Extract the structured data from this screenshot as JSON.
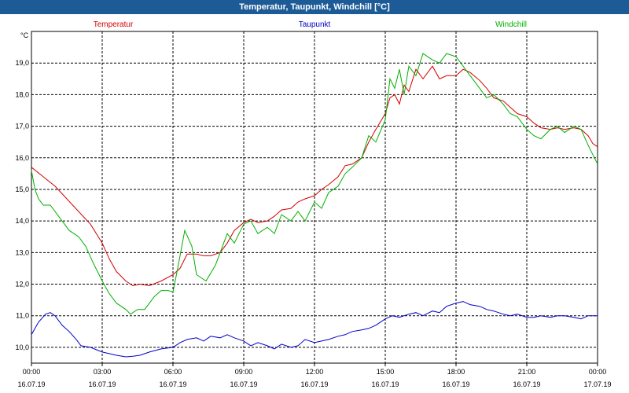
{
  "window": {
    "title": "Temperatur, Taupunkt, Windchill [°C]"
  },
  "chart_data": {
    "type": "line",
    "title": "Temperatur, Taupunkt, Windchill [°C]",
    "ylabel": "°C",
    "xlim": [
      0,
      24
    ],
    "ylim": [
      9.5,
      20.0
    ],
    "grid": true,
    "legend_position": "top",
    "y_ticks": [
      "10,0",
      "11,0",
      "12,0",
      "13,0",
      "14,0",
      "15,0",
      "16,0",
      "17,0",
      "18,0",
      "19,0"
    ],
    "y_tick_values": [
      10,
      11,
      12,
      13,
      14,
      15,
      16,
      17,
      18,
      19
    ],
    "x_ticks": [
      {
        "time": "00:00",
        "date": "16.07.19"
      },
      {
        "time": "03:00",
        "date": "16.07.19"
      },
      {
        "time": "06:00",
        "date": "16.07.19"
      },
      {
        "time": "09:00",
        "date": "16.07.19"
      },
      {
        "time": "12:00",
        "date": "16.07.19"
      },
      {
        "time": "15:00",
        "date": "16.07.19"
      },
      {
        "time": "18:00",
        "date": "16.07.19"
      },
      {
        "time": "21:00",
        "date": "16.07.19"
      },
      {
        "time": "00:00",
        "date": "17.07.19"
      }
    ],
    "series": [
      {
        "name": "Temperatur",
        "color": "#d40000",
        "points": [
          [
            0,
            15.7
          ],
          [
            0.5,
            15.4
          ],
          [
            1,
            15.1
          ],
          [
            1.5,
            14.7
          ],
          [
            2,
            14.3
          ],
          [
            2.5,
            13.9
          ],
          [
            3,
            13.3
          ],
          [
            3.3,
            12.8
          ],
          [
            3.6,
            12.4
          ],
          [
            4,
            12.1
          ],
          [
            4.3,
            11.95
          ],
          [
            4.6,
            12.0
          ],
          [
            5,
            11.95
          ],
          [
            5.5,
            12.1
          ],
          [
            6,
            12.3
          ],
          [
            6.3,
            12.5
          ],
          [
            6.6,
            12.95
          ],
          [
            7,
            12.95
          ],
          [
            7.3,
            12.9
          ],
          [
            7.6,
            12.9
          ],
          [
            8,
            13.0
          ],
          [
            8.3,
            13.3
          ],
          [
            8.6,
            13.7
          ],
          [
            9,
            13.95
          ],
          [
            9.3,
            14.05
          ],
          [
            9.6,
            13.95
          ],
          [
            10,
            14.0
          ],
          [
            10.3,
            14.15
          ],
          [
            10.6,
            14.35
          ],
          [
            11,
            14.4
          ],
          [
            11.3,
            14.6
          ],
          [
            11.6,
            14.7
          ],
          [
            12,
            14.8
          ],
          [
            12.3,
            15.0
          ],
          [
            12.6,
            15.15
          ],
          [
            13,
            15.4
          ],
          [
            13.3,
            15.75
          ],
          [
            13.6,
            15.8
          ],
          [
            14,
            16.0
          ],
          [
            14.3,
            16.5
          ],
          [
            14.6,
            16.9
          ],
          [
            15,
            17.4
          ],
          [
            15.2,
            17.9
          ],
          [
            15.4,
            18.0
          ],
          [
            15.6,
            17.7
          ],
          [
            15.8,
            18.3
          ],
          [
            16,
            18.1
          ],
          [
            16.3,
            18.8
          ],
          [
            16.6,
            18.5
          ],
          [
            17,
            18.9
          ],
          [
            17.3,
            18.5
          ],
          [
            17.6,
            18.6
          ],
          [
            18,
            18.6
          ],
          [
            18.3,
            18.8
          ],
          [
            18.6,
            18.7
          ],
          [
            19,
            18.45
          ],
          [
            19.3,
            18.2
          ],
          [
            19.6,
            17.9
          ],
          [
            20,
            17.8
          ],
          [
            20.3,
            17.6
          ],
          [
            20.6,
            17.4
          ],
          [
            21,
            17.3
          ],
          [
            21.3,
            17.1
          ],
          [
            21.6,
            16.95
          ],
          [
            22,
            16.9
          ],
          [
            22.3,
            16.95
          ],
          [
            22.6,
            16.9
          ],
          [
            23,
            16.95
          ],
          [
            23.3,
            16.9
          ],
          [
            23.6,
            16.7
          ],
          [
            23.8,
            16.45
          ],
          [
            24,
            16.35
          ]
        ]
      },
      {
        "name": "Taupunkt",
        "color": "#0000c8",
        "points": [
          [
            0,
            10.4
          ],
          [
            0.3,
            10.8
          ],
          [
            0.6,
            11.05
          ],
          [
            0.8,
            11.1
          ],
          [
            1,
            11.0
          ],
          [
            1.3,
            10.7
          ],
          [
            1.6,
            10.5
          ],
          [
            1.9,
            10.25
          ],
          [
            2.1,
            10.05
          ],
          [
            2.5,
            10.0
          ],
          [
            3,
            9.85
          ],
          [
            3.3,
            9.8
          ],
          [
            3.6,
            9.75
          ],
          [
            4,
            9.7
          ],
          [
            4.3,
            9.72
          ],
          [
            4.6,
            9.75
          ],
          [
            5,
            9.85
          ],
          [
            5.5,
            9.95
          ],
          [
            6,
            10.0
          ],
          [
            6.3,
            10.15
          ],
          [
            6.6,
            10.25
          ],
          [
            7,
            10.3
          ],
          [
            7.3,
            10.2
          ],
          [
            7.6,
            10.35
          ],
          [
            8,
            10.3
          ],
          [
            8.3,
            10.4
          ],
          [
            8.6,
            10.3
          ],
          [
            9,
            10.2
          ],
          [
            9.3,
            10.05
          ],
          [
            9.6,
            10.15
          ],
          [
            10,
            10.05
          ],
          [
            10.3,
            9.95
          ],
          [
            10.6,
            10.1
          ],
          [
            11,
            10.0
          ],
          [
            11.3,
            10.05
          ],
          [
            11.6,
            10.25
          ],
          [
            12,
            10.15
          ],
          [
            12.3,
            10.2
          ],
          [
            12.6,
            10.25
          ],
          [
            13,
            10.35
          ],
          [
            13.3,
            10.4
          ],
          [
            13.6,
            10.5
          ],
          [
            14,
            10.55
          ],
          [
            14.3,
            10.6
          ],
          [
            14.6,
            10.7
          ],
          [
            15,
            10.9
          ],
          [
            15.3,
            11.0
          ],
          [
            15.6,
            10.95
          ],
          [
            16,
            11.05
          ],
          [
            16.3,
            11.1
          ],
          [
            16.6,
            11.0
          ],
          [
            17,
            11.15
          ],
          [
            17.3,
            11.1
          ],
          [
            17.6,
            11.3
          ],
          [
            18,
            11.4
          ],
          [
            18.3,
            11.45
          ],
          [
            18.6,
            11.35
          ],
          [
            19,
            11.3
          ],
          [
            19.3,
            11.2
          ],
          [
            19.6,
            11.15
          ],
          [
            20,
            11.05
          ],
          [
            20.3,
            11.0
          ],
          [
            20.6,
            11.05
          ],
          [
            21,
            10.95
          ],
          [
            21.3,
            10.95
          ],
          [
            21.6,
            11.0
          ],
          [
            22,
            10.95
          ],
          [
            22.3,
            11.0
          ],
          [
            22.6,
            11.0
          ],
          [
            23,
            10.95
          ],
          [
            23.3,
            10.9
          ],
          [
            23.6,
            11.0
          ],
          [
            24,
            11.0
          ]
        ]
      },
      {
        "name": "Windchill",
        "color": "#00b000",
        "points": [
          [
            0,
            15.6
          ],
          [
            0.15,
            15.0
          ],
          [
            0.3,
            14.7
          ],
          [
            0.5,
            14.5
          ],
          [
            0.8,
            14.5
          ],
          [
            1,
            14.3
          ],
          [
            1.3,
            14.0
          ],
          [
            1.6,
            13.7
          ],
          [
            2,
            13.5
          ],
          [
            2.3,
            13.2
          ],
          [
            2.6,
            12.7
          ],
          [
            3,
            12.1
          ],
          [
            3.3,
            11.7
          ],
          [
            3.6,
            11.4
          ],
          [
            4,
            11.2
          ],
          [
            4.2,
            11.05
          ],
          [
            4.5,
            11.2
          ],
          [
            4.8,
            11.2
          ],
          [
            5.2,
            11.6
          ],
          [
            5.5,
            11.8
          ],
          [
            5.8,
            11.8
          ],
          [
            6,
            11.75
          ],
          [
            6.2,
            12.5
          ],
          [
            6.5,
            13.7
          ],
          [
            6.8,
            13.2
          ],
          [
            7,
            12.3
          ],
          [
            7.4,
            12.1
          ],
          [
            7.8,
            12.6
          ],
          [
            8,
            13.0
          ],
          [
            8.3,
            13.6
          ],
          [
            8.6,
            13.3
          ],
          [
            9,
            13.9
          ],
          [
            9.3,
            14.0
          ],
          [
            9.6,
            13.6
          ],
          [
            10,
            13.8
          ],
          [
            10.3,
            13.6
          ],
          [
            10.6,
            14.2
          ],
          [
            11,
            14.0
          ],
          [
            11.3,
            14.3
          ],
          [
            11.6,
            14.0
          ],
          [
            12,
            14.6
          ],
          [
            12.3,
            14.4
          ],
          [
            12.6,
            14.9
          ],
          [
            13,
            15.1
          ],
          [
            13.3,
            15.5
          ],
          [
            13.6,
            15.7
          ],
          [
            14,
            16.0
          ],
          [
            14.3,
            16.7
          ],
          [
            14.6,
            16.5
          ],
          [
            15,
            17.2
          ],
          [
            15.2,
            18.5
          ],
          [
            15.4,
            18.2
          ],
          [
            15.6,
            18.8
          ],
          [
            15.8,
            18.0
          ],
          [
            16,
            18.9
          ],
          [
            16.3,
            18.6
          ],
          [
            16.6,
            19.3
          ],
          [
            17,
            19.1
          ],
          [
            17.3,
            19.0
          ],
          [
            17.6,
            19.3
          ],
          [
            18,
            19.2
          ],
          [
            18.3,
            18.9
          ],
          [
            18.6,
            18.6
          ],
          [
            19,
            18.2
          ],
          [
            19.3,
            17.9
          ],
          [
            19.6,
            18.0
          ],
          [
            20,
            17.7
          ],
          [
            20.3,
            17.4
          ],
          [
            20.6,
            17.3
          ],
          [
            21,
            16.9
          ],
          [
            21.3,
            16.7
          ],
          [
            21.6,
            16.6
          ],
          [
            22,
            16.9
          ],
          [
            22.3,
            17.0
          ],
          [
            22.6,
            16.8
          ],
          [
            23,
            17.0
          ],
          [
            23.3,
            16.9
          ],
          [
            23.6,
            16.4
          ],
          [
            24,
            15.8
          ]
        ]
      }
    ]
  }
}
